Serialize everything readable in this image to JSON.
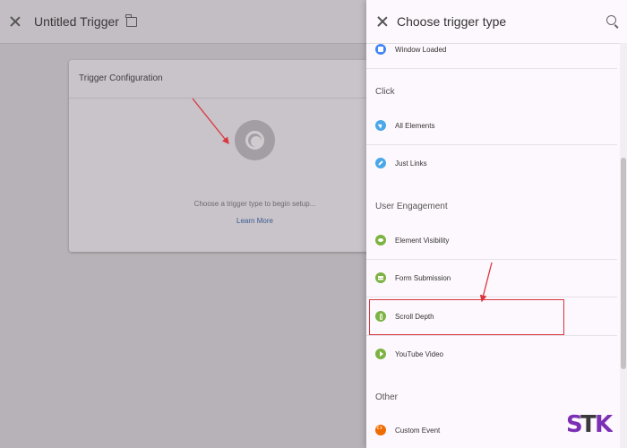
{
  "editor": {
    "title": "Untitled Trigger",
    "card_title": "Trigger Configuration",
    "setup_hint": "Choose a trigger type to begin setup...",
    "learn_more": "Learn More"
  },
  "drawer": {
    "title": "Choose trigger type",
    "items": [
      {
        "label": "Window Loaded",
        "icon": "window-icon"
      },
      {
        "label": "All Elements",
        "icon": "cursor-icon"
      },
      {
        "label": "Just Links",
        "icon": "link-icon"
      },
      {
        "label": "Element Visibility",
        "icon": "eye-icon"
      },
      {
        "label": "Form Submission",
        "icon": "form-icon"
      },
      {
        "label": "Scroll Depth",
        "icon": "scroll-icon"
      },
      {
        "label": "YouTube Video",
        "icon": "play-icon"
      },
      {
        "label": "Custom Event",
        "icon": "code-icon"
      }
    ],
    "sections": {
      "click": "Click",
      "user_engagement": "User Engagement",
      "other": "Other"
    }
  },
  "colors": {
    "annotation_red": "#d9363e",
    "accent_blue": "#4285f4",
    "engagement_green": "#7cb342",
    "other_orange": "#ef6c00"
  }
}
